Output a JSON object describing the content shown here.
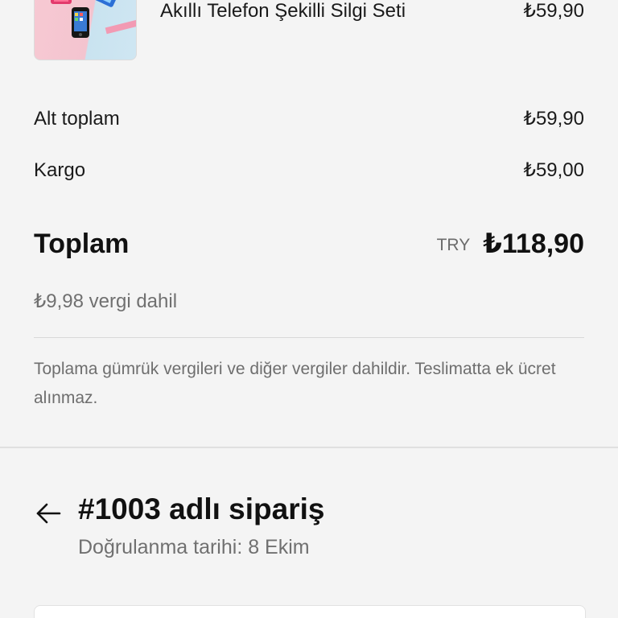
{
  "product": {
    "name": "Akıllı Telefon Şekilli Silgi Seti",
    "price": "₺59,90"
  },
  "summary": {
    "subtotal_label": "Alt toplam",
    "subtotal_value": "₺59,90",
    "shipping_label": "Kargo",
    "shipping_value": "₺59,00",
    "total_label": "Toplam",
    "total_currency": "TRY",
    "total_value": "₺118,90",
    "tax_note": "₺9,98 vergi dahil",
    "duties_note": "Toplama gümrük vergileri ve diğer vergiler dahildir. Teslimatta ek ücret alınmaz."
  },
  "order": {
    "title": "#1003 adlı sipariş",
    "confirmed": "Doğrulanma tarihi: 8 Ekim"
  },
  "icons": {
    "back": "arrow-left-icon",
    "product": "product-thumbnail"
  },
  "colors": {
    "background": "#f4f4f4",
    "text": "#1a1a1a",
    "muted": "#707070"
  }
}
